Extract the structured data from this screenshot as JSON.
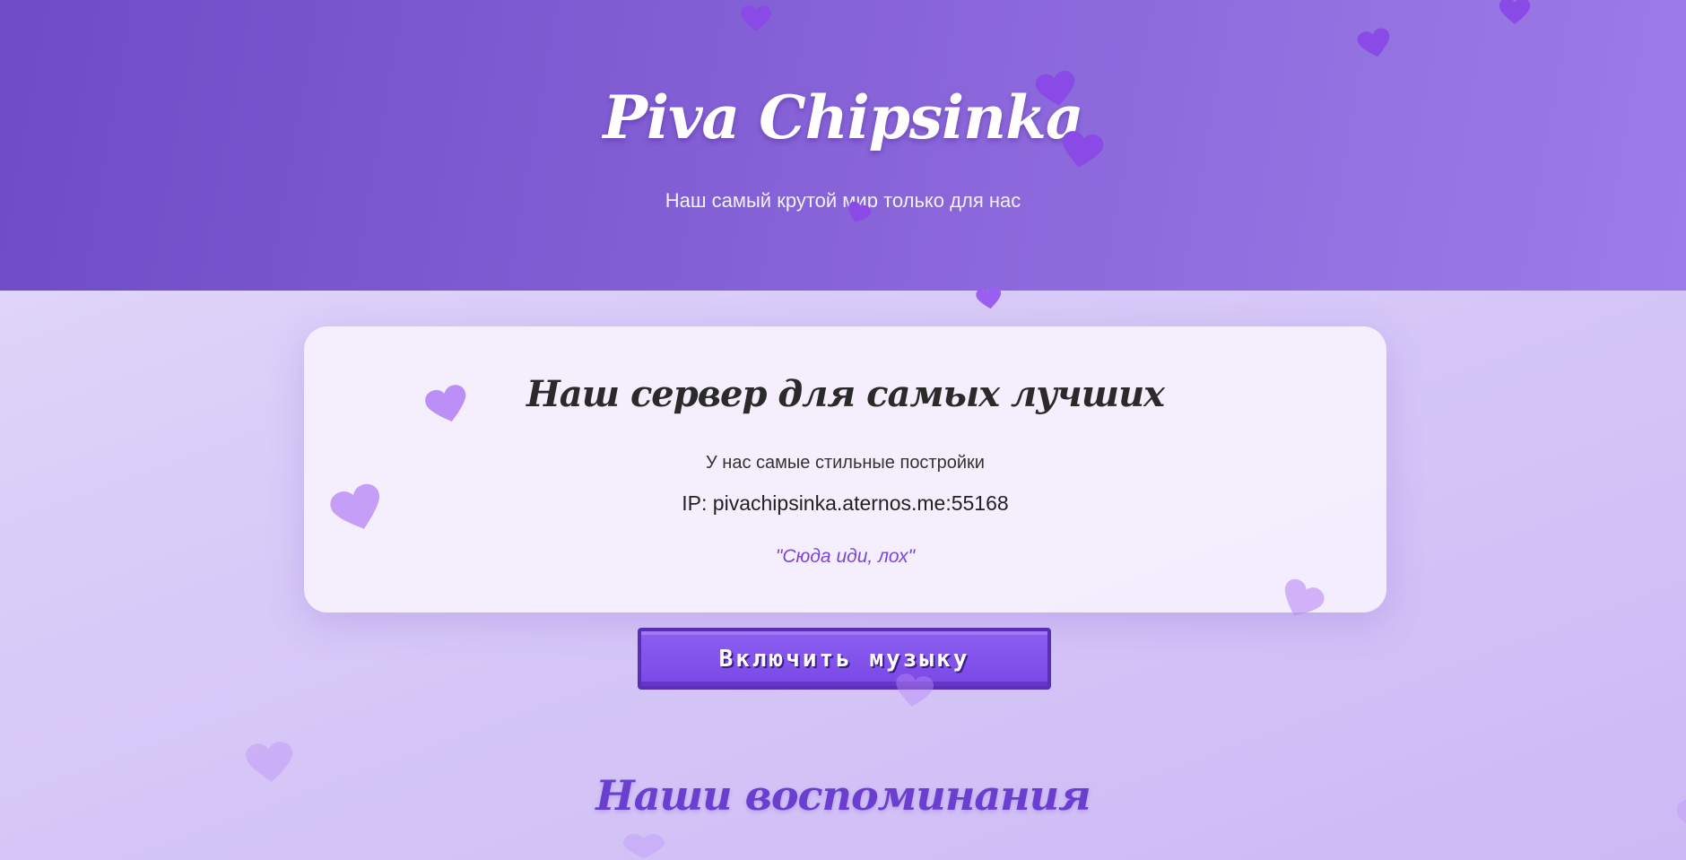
{
  "header": {
    "title": "Piva Chipsinka",
    "subtitle": "Наш самый крутой мир только для нас"
  },
  "server_card": {
    "title": "Наш сервер для самых лучших",
    "description": "У нас самые стильные постройки",
    "ip": "IP: pivachipsinka.aternos.me:55168",
    "quote": "\"Сюда иди, лох\""
  },
  "music_button": {
    "label": "Включить музыку"
  },
  "memories": {
    "title": "Наши воспоминания"
  },
  "colors": {
    "header_gradient_start": "#6e4cc6",
    "header_gradient_end": "#9c7ce8",
    "page_background": "#d9ccf8",
    "accent_purple": "#7a45d8",
    "button_purple": "#8c5ff0",
    "heart_purple": "#8a4ae6"
  },
  "decorations": {
    "icon": "heart-icon"
  }
}
